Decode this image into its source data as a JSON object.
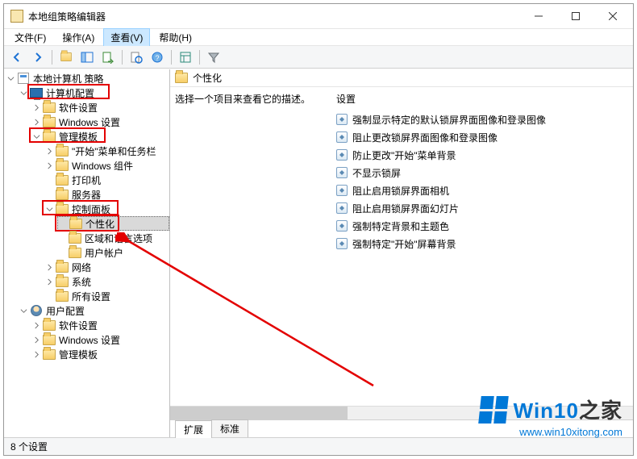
{
  "window": {
    "title": "本地组策略编辑器"
  },
  "menu": {
    "items": [
      "文件(F)",
      "操作(A)",
      "查看(V)",
      "帮助(H)"
    ],
    "active_index": 2
  },
  "tree": {
    "root": "本地计算机 策略",
    "computer_config": "计算机配置",
    "sw_settings": "软件设置",
    "win_settings": "Windows 设置",
    "admin_templates": "管理模板",
    "start_taskbar": "\"开始\"菜单和任务栏",
    "win_components": "Windows 组件",
    "printers": "打印机",
    "server": "服务器",
    "control_panel": "控制面板",
    "personalization": "个性化",
    "region_lang": "区域和语言选项",
    "user_accounts": "用户帐户",
    "network": "网络",
    "system": "系统",
    "all_settings": "所有设置",
    "user_config": "用户配置",
    "u_sw_settings": "软件设置",
    "u_win_settings": "Windows 设置",
    "u_admin_templates": "管理模板"
  },
  "content": {
    "header": "个性化",
    "description": "选择一个项目来查看它的描述。",
    "column_header": "设置",
    "items": [
      "强制显示特定的默认锁屏界面图像和登录图像",
      "阻止更改锁屏界面图像和登录图像",
      "防止更改\"开始\"菜单背景",
      "不显示锁屏",
      "阻止启用锁屏界面相机",
      "阻止启用锁屏界面幻灯片",
      "强制特定背景和主题色",
      "强制特定\"开始\"屏幕背景"
    ]
  },
  "tabs": {
    "extended": "扩展",
    "standard": "标准",
    "active": 0
  },
  "status": {
    "text": "8 个设置"
  },
  "watermark": {
    "brand_left": "Win10",
    "brand_right": "之家",
    "url": "www.win10xitong.com"
  }
}
